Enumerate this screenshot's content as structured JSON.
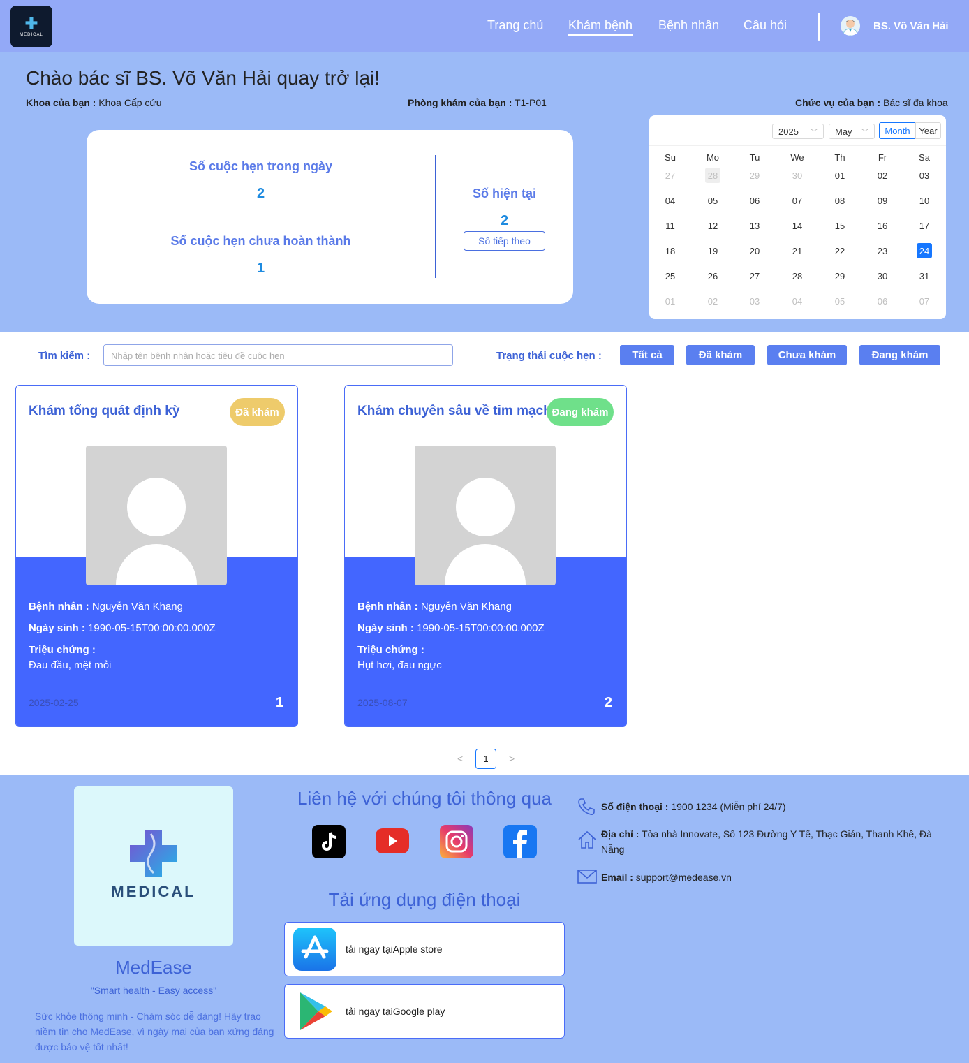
{
  "header": {
    "logo_text": "MEDICAL",
    "nav": [
      "Trang chủ",
      "Khám bệnh",
      "Bệnh nhân",
      "Câu hỏi"
    ],
    "active_nav": "Khám bệnh",
    "username": "BS. Võ Văn Hải"
  },
  "hero": {
    "greeting": "Chào bác sĩ BS. Võ Văn Hải quay trở lại!",
    "dept_label": "Khoa của bạn :",
    "dept_value": " Khoa Cấp cứu",
    "room_label": "Phòng khám của bạn :",
    "room_value": " T1-P01",
    "role_label": "Chức vụ của bạn :",
    "role_value": " Bác sĩ đa khoa"
  },
  "stats": {
    "today_label": "Số cuộc hẹn trong ngày",
    "today_value": "2",
    "pending_label": "Số cuộc hẹn chưa hoàn thành",
    "pending_value": "1",
    "current_label": "Số hiện tại",
    "current_value": "2",
    "next_button": "Số tiếp theo"
  },
  "calendar": {
    "year": "2025",
    "month": "May",
    "mode_month": "Month",
    "mode_year": "Year",
    "weekdays": [
      "Su",
      "Mo",
      "Tu",
      "We",
      "Th",
      "Fr",
      "Sa"
    ],
    "weeks": [
      [
        "27",
        "28",
        "29",
        "30",
        "01",
        "02",
        "03"
      ],
      [
        "04",
        "05",
        "06",
        "07",
        "08",
        "09",
        "10"
      ],
      [
        "11",
        "12",
        "13",
        "14",
        "15",
        "16",
        "17"
      ],
      [
        "18",
        "19",
        "20",
        "21",
        "22",
        "23",
        "24"
      ],
      [
        "25",
        "26",
        "27",
        "28",
        "29",
        "30",
        "31"
      ],
      [
        "01",
        "02",
        "03",
        "04",
        "05",
        "06",
        "07"
      ]
    ],
    "today": "28",
    "selected": "24"
  },
  "filter": {
    "search_label": "Tìm kiếm :",
    "search_placeholder": "Nhập tên bệnh nhân hoặc tiêu đề cuộc hẹn",
    "status_label": "Trạng thái cuộc hẹn :",
    "buttons": [
      "Tất cả",
      "Đã khám",
      "Chưa khám",
      "Đang khám"
    ]
  },
  "appointments": [
    {
      "title": "Khám tổng quát định kỳ",
      "status": "Đã khám",
      "status_color": "#eecb6b",
      "patient_label": "Bệnh nhân :",
      "patient": " Nguyễn Văn Khang",
      "dob_label": "Ngày sinh :",
      "dob": " 1990-05-15T00:00:00.000Z",
      "symptom_label": "Triệu chứng :",
      "symptom": "Đau đầu, mệt mỏi",
      "date": "2025-02-25",
      "number": "1"
    },
    {
      "title": "Khám chuyên sâu về tim mạch",
      "status": "Đang khám",
      "status_color": "#6fe08a",
      "patient_label": "Bệnh nhân :",
      "patient": " Nguyễn Văn Khang",
      "dob_label": "Ngày sinh :",
      "dob": " 1990-05-15T00:00:00.000Z",
      "symptom_label": "Triệu chứng :",
      "symptom": "Hụt hơi, đau ngực",
      "date": "2025-08-07",
      "number": "2"
    }
  ],
  "pagination": {
    "current": "1",
    "prev": "<",
    "next": ">"
  },
  "footer": {
    "logo_text": "MEDICAL",
    "brand": "MedEase",
    "slogan": "\"Smart health - Easy access\"",
    "description": "Sức khỏe thông minh - Chăm sóc dễ dàng! Hãy trao niềm tin cho MedEase, vì ngày mai của bạn xứng đáng được bảo vệ tốt nhất!",
    "contact_heading": "Liên hệ với chúng tôi thông qua",
    "app_heading": "Tải ứng dụng điện thoại",
    "apple_store": "tải ngay tạiApple store",
    "google_play": "tải ngay tạiGoogle play",
    "phone_label": "Số điện thoại :",
    "phone": " 1900 1234 (Miễn phí 24/7)",
    "address_label": "Địa chỉ :",
    "address": " Tòa nhà Innovate, Số 123 Đường Y Tế, Thạc Gián, Thanh Khê, Đà Nẵng",
    "email_label": "Email :",
    "email": " support@medease.vn",
    "socials": [
      "tiktok-icon",
      "youtube-icon",
      "instagram-icon",
      "facebook-icon"
    ]
  }
}
